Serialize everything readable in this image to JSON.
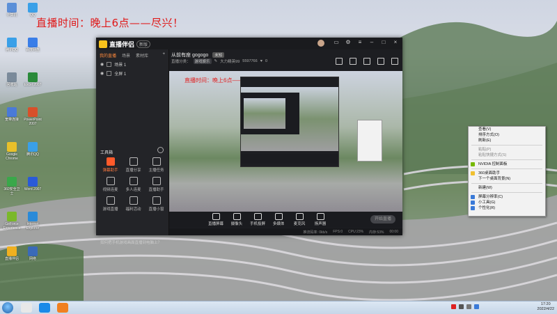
{
  "overlay_title": "直播时间：晚上6点——尽兴！",
  "desktop_icons": [
    {
      "label": "计算机",
      "color": "#5b8fd8"
    },
    {
      "label": "QQ",
      "color": "#3aa0e8"
    },
    {
      "label": "腾讯QQ",
      "color": "#3aa0e8"
    },
    {
      "label": "百度网盘",
      "color": "#3a7ee8"
    },
    {
      "label": "回收站",
      "color": "#7a8a9a"
    },
    {
      "label": "Excel 2007",
      "color": "#2a8a3a"
    },
    {
      "label": "宽带连接",
      "color": "#4a7ad8"
    },
    {
      "label": "PowerPoint 2007",
      "color": "#d8502a"
    },
    {
      "label": "Google Chrome",
      "color": "#e8c02a"
    },
    {
      "label": "腾讯QQ",
      "color": "#3aa0e8"
    },
    {
      "label": "360安全卫士",
      "color": "#3aa84a"
    },
    {
      "label": "Word 2007",
      "color": "#2a5ad8"
    },
    {
      "label": "GeForce Experience",
      "color": "#7ab82a"
    },
    {
      "label": "Internet Explorer",
      "color": "#2a8ad8"
    },
    {
      "label": "直播伴侣",
      "color": "#f0b020"
    },
    {
      "label": "网络",
      "color": "#3a6ab8"
    }
  ],
  "app": {
    "brand": "直播伴侣",
    "version": "新版",
    "side_tabs": [
      "我的直播",
      "场景",
      "素材库"
    ],
    "scenes": [
      "场景 1",
      "全屏 1"
    ],
    "tools_title": "工具箱",
    "tools": [
      {
        "label": "弹幕助手",
        "hot": true
      },
      {
        "label": "直播分享",
        "hot": false
      },
      {
        "label": "主播任务",
        "hot": false
      },
      {
        "label": "视频连麦",
        "hot": false
      },
      {
        "label": "多人连麦",
        "hot": false
      },
      {
        "label": "直播助手",
        "hot": false
      },
      {
        "label": "游戏直播",
        "hot": false
      },
      {
        "label": "福利活动",
        "hot": false
      },
      {
        "label": "直播小窗",
        "hot": false
      }
    ],
    "notice": "如何把手机游戏画面直播到电脑上？",
    "room_title": "从前有座 gogogo",
    "room_tag": "未知",
    "room_category": "游戏娱乐",
    "room_sub_prefix": "直播分类：",
    "room_host": "大力精英99",
    "room_id": "5597766",
    "room_count": "0",
    "preview_title": "直播时间：晚上6点——尽兴！",
    "controls": [
      "直播屏幕",
      "摄像头",
      "手机投屏",
      "多媒体",
      "麦克风",
      "扬声器"
    ],
    "live_button": "开始直播",
    "status": [
      "推流码率: 0kb/s",
      "FPS:0",
      "CPU:23%",
      "内存:53%",
      "00:00"
    ]
  },
  "context_menu": [
    {
      "label": "查看(V)",
      "dim": false
    },
    {
      "label": "排序方式(O)",
      "dim": false
    },
    {
      "label": "刷新(E)",
      "dim": false
    },
    {
      "sep": true
    },
    {
      "label": "粘贴(P)",
      "dim": true
    },
    {
      "label": "粘贴快捷方式(S)",
      "dim": true
    },
    {
      "sep": true
    },
    {
      "label": "NVIDIA 控制面板",
      "dim": false,
      "icon": "#76b900"
    },
    {
      "sep": true
    },
    {
      "label": "360桌面助手",
      "dim": false,
      "icon": "#f0c030"
    },
    {
      "label": "下一个桌面背景(N)",
      "dim": false
    },
    {
      "sep": true
    },
    {
      "label": "新建(W)",
      "dim": false
    },
    {
      "sep": true
    },
    {
      "label": "屏幕分辨率(C)",
      "dim": false,
      "icon": "#3a7ad8"
    },
    {
      "label": "小工具(G)",
      "dim": false,
      "icon": "#3a7ad8"
    },
    {
      "label": "个性化(R)",
      "dim": false,
      "icon": "#3a7ad8"
    }
  ],
  "taskbar": {
    "apps": [
      {
        "name": "qq-taskbar-icon",
        "color": "#e8e8e8"
      },
      {
        "name": "kugou-taskbar-icon",
        "color": "#1a8ae8"
      },
      {
        "name": "zhibo-taskbar-icon",
        "color": "#f08020"
      }
    ],
    "time": "17:20",
    "date": "2022/4/22"
  }
}
